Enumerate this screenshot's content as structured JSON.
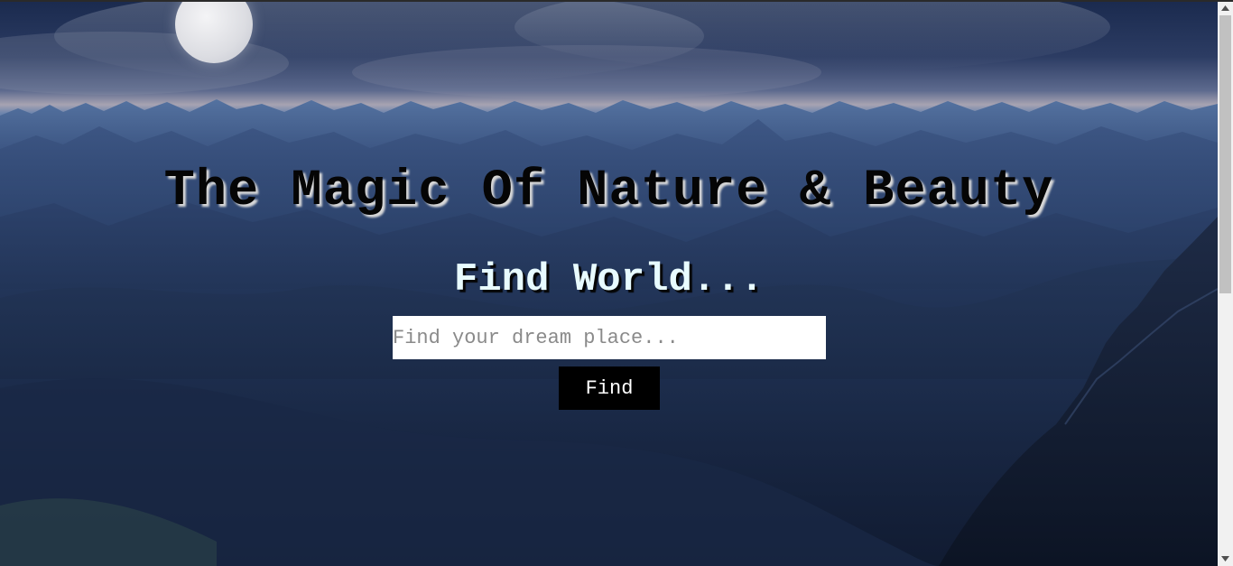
{
  "hero": {
    "title": "The Magic Of Nature & Beauty",
    "subtitle": "Find World..."
  },
  "search": {
    "placeholder": "Find your dream place...",
    "value": ""
  },
  "find_button": {
    "label": "Find"
  },
  "colors": {
    "sky": "#1a2a4e",
    "mountains": "#2f4774",
    "heading_text": "#050505",
    "subheading_text": "#e8fbff",
    "button_bg": "#000000",
    "button_text": "#ffffff"
  },
  "icons": {
    "scroll_up": "triangle-up-icon",
    "scroll_down": "triangle-down-icon"
  }
}
